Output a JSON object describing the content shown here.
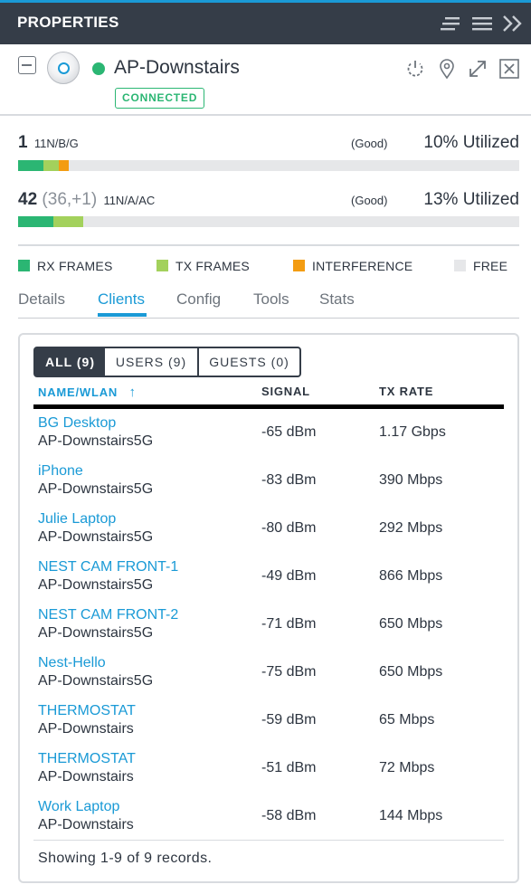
{
  "header": {
    "title": "PROPERTIES"
  },
  "device": {
    "name": "AP-Downstairs",
    "status_badge": "CONNECTED",
    "status_color": "#2bb673"
  },
  "radios": [
    {
      "channel": "1",
      "extra": "",
      "mode": "11N/B/G",
      "quality": "(Good)",
      "utilization": "10% Utilized",
      "usage": {
        "rx": 0.05,
        "tx": 0.03,
        "interference": 0.02
      }
    },
    {
      "channel": "42",
      "extra": "(36,+1)",
      "mode": "11N/A/AC",
      "quality": "(Good)",
      "utilization": "13% Utilized",
      "usage": {
        "rx": 0.07,
        "tx": 0.06,
        "interference": 0.0
      }
    }
  ],
  "legend": {
    "rx": "RX FRAMES",
    "tx": "TX FRAMES",
    "interference": "INTERFERENCE",
    "free": "FREE"
  },
  "colors": {
    "rx": "#2bb673",
    "tx": "#a3d15c",
    "interference": "#f39c12",
    "free": "#e6e7e9",
    "accent": "#1a9ad6",
    "header_bg": "#353d48"
  },
  "tabs": [
    "Details",
    "Clients",
    "Config",
    "Tools",
    "Stats"
  ],
  "active_tab": "Clients",
  "filters": {
    "all": "ALL (9)",
    "users": "USERS (9)",
    "guests": "GUESTS (0)"
  },
  "columns": {
    "name": "NAME/WLAN",
    "sort_icon": "↑",
    "signal": "SIGNAL",
    "tx_rate": "TX RATE"
  },
  "clients": [
    {
      "name": "BG Desktop",
      "wlan": "AP-Downstairs5G",
      "signal": "-65 dBm",
      "tx_rate": "1.17 Gbps"
    },
    {
      "name": "iPhone",
      "wlan": "AP-Downstairs5G",
      "signal": "-83 dBm",
      "tx_rate": "390 Mbps"
    },
    {
      "name": "Julie Laptop",
      "wlan": "AP-Downstairs5G",
      "signal": "-80 dBm",
      "tx_rate": "292 Mbps"
    },
    {
      "name": "NEST CAM FRONT-1",
      "wlan": "AP-Downstairs5G",
      "signal": "-49 dBm",
      "tx_rate": "866 Mbps"
    },
    {
      "name": "NEST CAM FRONT-2",
      "wlan": "AP-Downstairs5G",
      "signal": "-71 dBm",
      "tx_rate": "650 Mbps"
    },
    {
      "name": "Nest-Hello",
      "wlan": "AP-Downstairs5G",
      "signal": "-75 dBm",
      "tx_rate": "650 Mbps"
    },
    {
      "name": "THERMOSTAT",
      "wlan": "AP-Downstairs",
      "signal": "-59 dBm",
      "tx_rate": "65 Mbps"
    },
    {
      "name": "THERMOSTAT",
      "wlan": "AP-Downstairs",
      "signal": "-51 dBm",
      "tx_rate": "72 Mbps"
    },
    {
      "name": "Work Laptop",
      "wlan": "AP-Downstairs",
      "signal": "-58 dBm",
      "tx_rate": "144 Mbps"
    }
  ],
  "footer": {
    "text": "Showing 1-9 of 9 records."
  }
}
